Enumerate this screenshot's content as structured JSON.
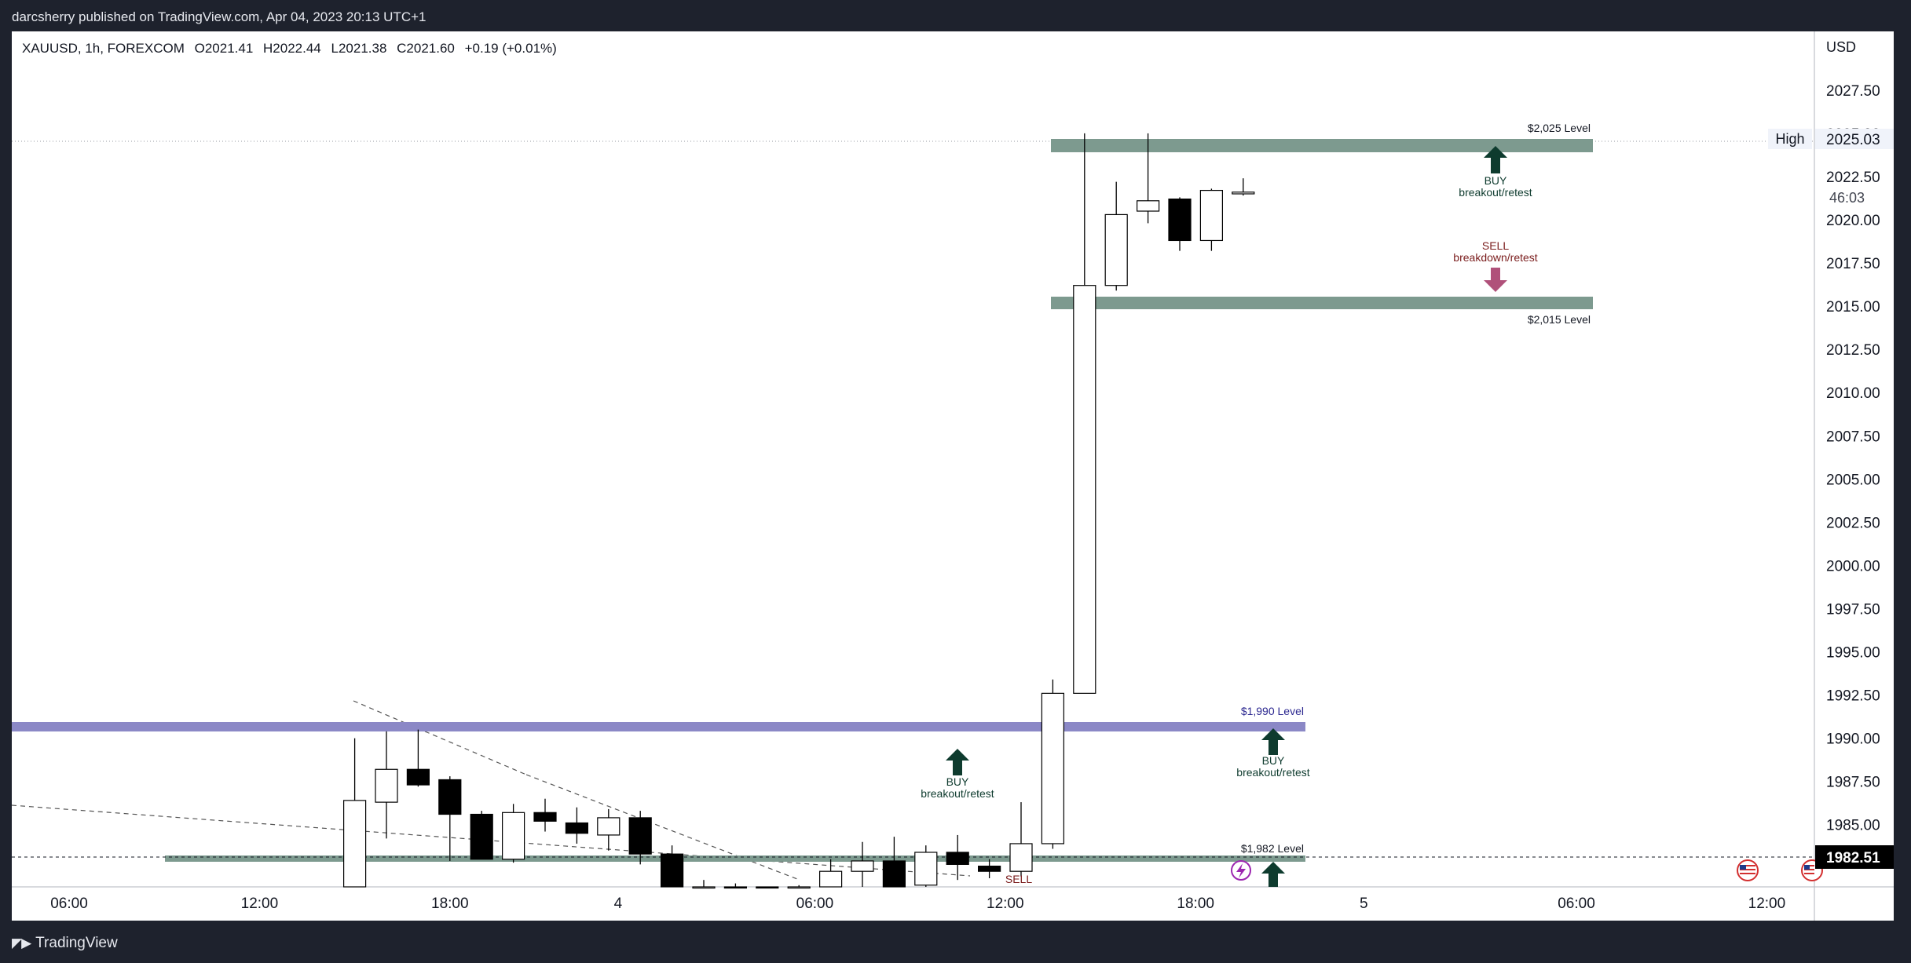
{
  "header": {
    "publisher": "darcsherry published on TradingView.com, Apr 04, 2023 20:13 UTC+1"
  },
  "legend": {
    "symbol": "XAUUSD, 1h, FOREXCOM",
    "open": "O2021.41",
    "high": "H2022.44",
    "low": "L2021.38",
    "close": "C2021.60",
    "change": "+0.19 (+0.01%)"
  },
  "price_axis": {
    "currency": "USD",
    "high_label": "High",
    "high_value": "2025.03",
    "countdown": "46:03",
    "last_price": "1982.51"
  },
  "footer": {
    "brand": "TradingView"
  },
  "colors": {
    "bull_body": "#ffffff",
    "bear_body": "#000000",
    "level_zone": "#7d9a8f",
    "level_1990": "#8b88c6",
    "buy_arrow": "#0e3b2e",
    "sell_arrow": "#b0517a",
    "sell_text": "#7a1c1c",
    "background": "#ffffff",
    "frame": "#1e222d"
  },
  "icons": {
    "event_bolt": "lightning-icon",
    "econ_flag": "us-flag-icon"
  },
  "annotations": {
    "level_2025": "$2,025 Level",
    "level_2015": "$2,015 Level",
    "level_1990": "$1,990 Level",
    "level_1982": "$1,982 Level",
    "buy_top_1": "BUY",
    "buy_top_2": "breakout/retest",
    "sell_top_1": "SELL",
    "sell_top_2": "breakdown/retest",
    "buy_mid_1": "BUY",
    "buy_mid_2": "breakout/retest",
    "buy_1990_1": "BUY",
    "buy_1990_2": "breakout/retest",
    "sell_low": "SELL"
  },
  "chart_data": {
    "type": "candlestick",
    "symbol": "XAUUSD",
    "interval": "1h",
    "ylim": [
      1981.4,
      2030.9
    ],
    "y_ticks": [
      "2027.50",
      "2025.00",
      "2022.50",
      "2020.00",
      "2017.50",
      "2015.00",
      "2012.50",
      "2010.00",
      "2007.50",
      "2005.00",
      "2002.50",
      "2000.00",
      "1997.50",
      "1995.00",
      "1992.50",
      "1990.00",
      "1987.50",
      "1985.00"
    ],
    "x_ticks": [
      {
        "label": "06:00",
        "t": 0
      },
      {
        "label": "12:00",
        "t": 6
      },
      {
        "label": "18:00",
        "t": 12
      },
      {
        "label": "4",
        "t": 17.3
      },
      {
        "label": "06:00",
        "t": 23.5
      },
      {
        "label": "12:00",
        "t": 29.5
      },
      {
        "label": "18:00",
        "t": 35.5
      },
      {
        "label": "5",
        "t": 40.8
      },
      {
        "label": "06:00",
        "t": 47.5
      },
      {
        "label": "12:00",
        "t": 53.5
      }
    ],
    "candles": [
      {
        "t": 9,
        "o": 1981.0,
        "h": 1990.0,
        "l": 1980.0,
        "c": 1986.4
      },
      {
        "t": 10,
        "o": 1986.3,
        "h": 1990.4,
        "l": 1984.2,
        "c": 1988.2
      },
      {
        "t": 11,
        "o": 1988.2,
        "h": 1990.5,
        "l": 1987.2,
        "c": 1987.3
      },
      {
        "t": 12,
        "o": 1987.6,
        "h": 1987.8,
        "l": 1982.9,
        "c": 1985.6
      },
      {
        "t": 13,
        "o": 1985.6,
        "h": 1985.8,
        "l": 1983.0,
        "c": 1983.0
      },
      {
        "t": 14,
        "o": 1983.0,
        "h": 1986.2,
        "l": 1982.8,
        "c": 1985.7
      },
      {
        "t": 15,
        "o": 1985.7,
        "h": 1986.5,
        "l": 1984.6,
        "c": 1985.2
      },
      {
        "t": 16,
        "o": 1985.1,
        "h": 1986.0,
        "l": 1983.9,
        "c": 1984.5
      },
      {
        "t": 17,
        "o": 1984.4,
        "h": 1985.9,
        "l": 1983.5,
        "c": 1985.4
      },
      {
        "t": 18,
        "o": 1985.4,
        "h": 1985.8,
        "l": 1982.7,
        "c": 1983.3
      },
      {
        "t": 19,
        "o": 1983.3,
        "h": 1983.8,
        "l": 1980.0,
        "c": 1980.5
      },
      {
        "t": 20,
        "o": 1981.0,
        "h": 1981.8,
        "l": 1980.0,
        "c": 1981.2
      },
      {
        "t": 21,
        "o": 1981.3,
        "h": 1981.6,
        "l": 1980.0,
        "c": 1980.5
      },
      {
        "t": 22,
        "o": 1980.5,
        "h": 1981.0,
        "l": 1979.8,
        "c": 1980.4
      },
      {
        "t": 23,
        "o": 1980.4,
        "h": 1981.5,
        "l": 1979.8,
        "c": 1980.8
      },
      {
        "t": 24,
        "o": 1980.8,
        "h": 1983.0,
        "l": 1980.2,
        "c": 1982.3
      },
      {
        "t": 25,
        "o": 1982.3,
        "h": 1984.0,
        "l": 1981.2,
        "c": 1982.9
      },
      {
        "t": 26,
        "o": 1982.9,
        "h": 1984.3,
        "l": 1981.0,
        "c": 1981.2
      },
      {
        "t": 27,
        "o": 1981.5,
        "h": 1983.8,
        "l": 1981.3,
        "c": 1983.4
      },
      {
        "t": 28,
        "o": 1983.4,
        "h": 1984.4,
        "l": 1981.8,
        "c": 1982.7
      },
      {
        "t": 29,
        "o": 1982.6,
        "h": 1983.0,
        "l": 1981.9,
        "c": 1982.3
      },
      {
        "t": 30,
        "o": 1982.3,
        "h": 1986.3,
        "l": 1982.0,
        "c": 1983.9
      },
      {
        "t": 31,
        "o": 1983.9,
        "h": 1993.4,
        "l": 1983.6,
        "c": 1992.6
      },
      {
        "t": 32,
        "o": 1992.6,
        "h": 2025.0,
        "l": 1992.6,
        "c": 2016.2
      },
      {
        "t": 33,
        "o": 2016.2,
        "h": 2022.2,
        "l": 2015.9,
        "c": 2020.3
      },
      {
        "t": 34,
        "o": 2020.5,
        "h": 2025.0,
        "l": 2019.8,
        "c": 2021.1
      },
      {
        "t": 35,
        "o": 2021.2,
        "h": 2021.3,
        "l": 2018.2,
        "c": 2018.8
      },
      {
        "t": 36,
        "o": 2018.8,
        "h": 2021.8,
        "l": 2018.2,
        "c": 2021.7
      },
      {
        "t": 37,
        "o": 2021.5,
        "h": 2022.4,
        "l": 2021.4,
        "c": 2021.6
      }
    ],
    "levels": [
      {
        "name": "$2,025 Level",
        "price": 2025.0
      },
      {
        "name": "$2,015 Level",
        "price": 2015.3
      },
      {
        "name": "$1,990 Level",
        "price": 1990.0
      },
      {
        "name": "$1,982 Level",
        "price": 1982.2
      }
    ]
  }
}
